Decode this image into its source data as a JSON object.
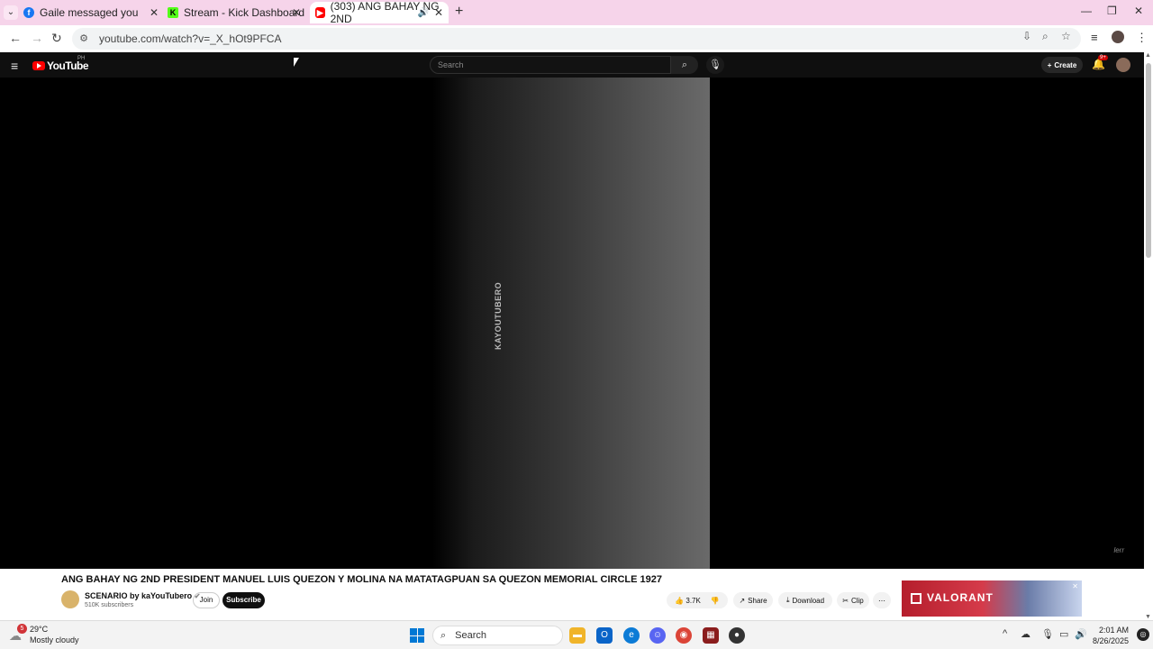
{
  "browser": {
    "tabs": [
      {
        "label": "Gaile messaged you",
        "icon": "facebook-icon",
        "active": false
      },
      {
        "label": "Stream - Kick Dashboard",
        "icon": "kick-icon",
        "active": false
      },
      {
        "label": "(303) ANG BAHAY NG 2ND",
        "icon": "youtube-icon",
        "active": true
      }
    ],
    "url": "youtube.com/watch?v=_X_hOt9PFCA"
  },
  "youtube": {
    "logo_text": "YouTube",
    "country": "PH",
    "search_placeholder": "Search",
    "create_label": "Create",
    "notification_count": "9+"
  },
  "video": {
    "overlay_text": "KAYOUTUBERO",
    "watermark": "lerr",
    "title": "ANG BAHAY NG 2ND PRESIDENT MANUEL LUIS QUEZON Y MOLINA NA MATATAGPUAN SA QUEZON MEMORIAL CIRCLE 1927",
    "channel_name": "SCENARIO by kaYouTubero",
    "subscribers": "510K subscribers",
    "join_label": "Join",
    "subscribe_label": "Subscribe",
    "likes": "3.7K",
    "share_label": "Share",
    "download_label": "Download",
    "clip_label": "Clip"
  },
  "ad": {
    "brand": "VALORANT"
  },
  "taskbar": {
    "weather_temp": "29°C",
    "weather_desc": "Mostly cloudy",
    "weather_badge": "5",
    "search_label": "Search",
    "time": "2:01 AM",
    "date": "8/26/2025"
  }
}
